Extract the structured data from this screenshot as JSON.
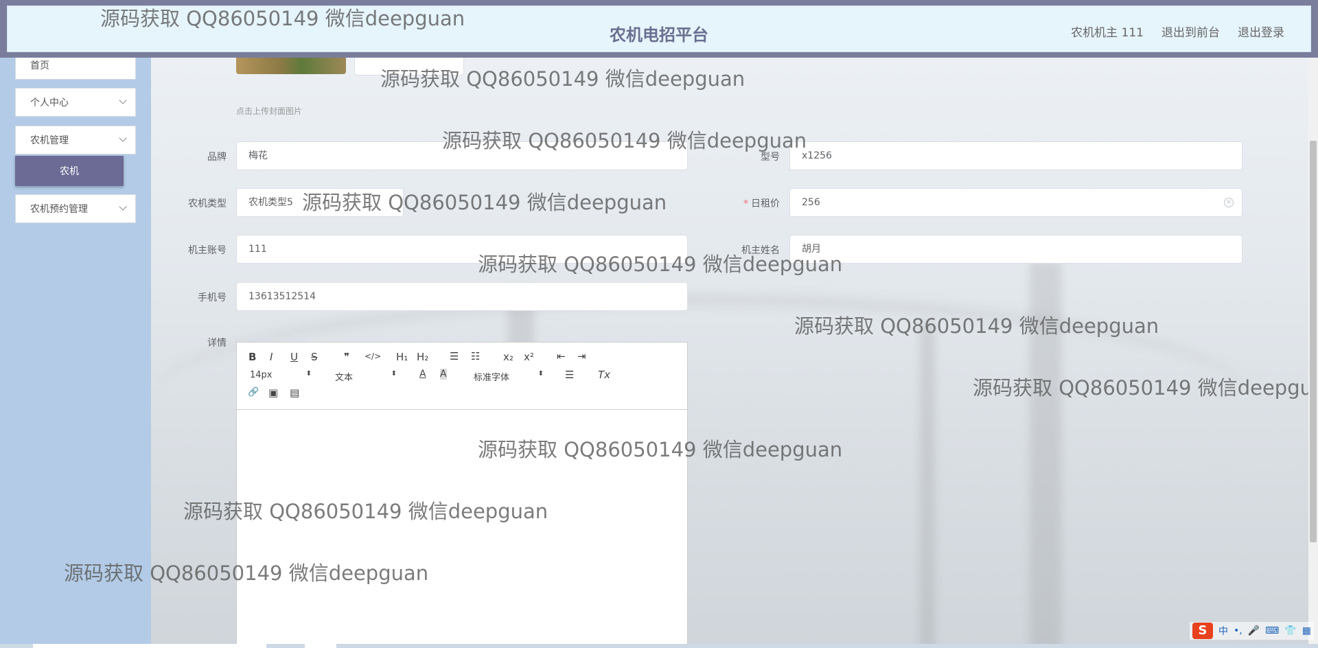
{
  "header": {
    "title": "农机电招平台",
    "user_label": "农机机主 111",
    "back_to_front": "退出到前台",
    "logout": "退出登录"
  },
  "sidebar": {
    "items": [
      {
        "label": "首页"
      },
      {
        "label": "个人中心"
      },
      {
        "label": "农机管理"
      },
      {
        "label": "农机预约管理"
      }
    ],
    "active_submenu": "农机"
  },
  "form": {
    "upload_hint": "点击上传封面图片",
    "brand": {
      "label": "品牌",
      "value": "梅花"
    },
    "model": {
      "label": "型号",
      "value": "x1256"
    },
    "machine_type": {
      "label": "农机类型",
      "value": "农机类型5"
    },
    "daily_rent": {
      "label": "日租价",
      "value": "256",
      "required_mark": "*"
    },
    "owner_account": {
      "label": "机主账号",
      "value": "111"
    },
    "owner_name": {
      "label": "机主姓名",
      "value": "胡月"
    },
    "phone": {
      "label": "手机号",
      "value": "13613512514"
    },
    "details": {
      "label": "详情"
    }
  },
  "editor_toolbar": {
    "bold": "B",
    "italic": "I",
    "underline": "U",
    "strike": "S",
    "quote": "❞",
    "code": "</>",
    "h1": "H₁",
    "h2": "H₂",
    "ordered_list": "☰",
    "bullet_list": "☷",
    "subscript": "x₂",
    "superscript": "x²",
    "outdent": "⇤",
    "indent": "⇥",
    "font_size": "14px",
    "format": "文本",
    "color": "A",
    "background": "A",
    "font_family": "标准字体",
    "align": "☰",
    "clean": "Tx",
    "link": "🔗",
    "image": "▣",
    "video": "▤"
  },
  "watermark": "源码获取 QQ86050149 微信deepguan",
  "ime": {
    "logo": "S",
    "mode": "中",
    "punct": "•,",
    "mic": "🎤",
    "keyboard": "⌨",
    "skin": "👕",
    "tools": "▦"
  },
  "colors": {
    "sidebar_bg": "#b3cbe6",
    "header_bg": "#7a7d9c",
    "active_menu": "#6b6b95",
    "required": "#f56c6c"
  }
}
